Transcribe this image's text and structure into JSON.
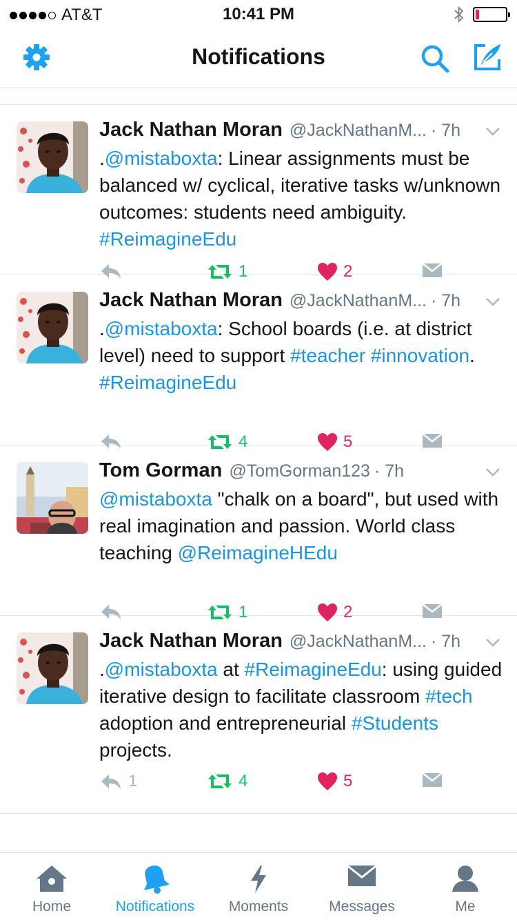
{
  "status_bar": {
    "carrier": "AT&T",
    "time": "10:41 PM",
    "signal_bars_filled": 4,
    "signal_bars_total": 5,
    "battery_level": 0.05
  },
  "nav": {
    "title": "Notifications",
    "icons": [
      "gear-icon",
      "search-icon",
      "compose-icon"
    ]
  },
  "colors": {
    "accent": "#1da1f2",
    "link": "#1b95e0",
    "retweet": "#17bf63",
    "like": "#e0245e",
    "muted": "#657786"
  },
  "tweets": [
    {
      "name": "Jack Nathan Moran",
      "handle": "@JackNathanM...",
      "time": "· 7h",
      "text": [
        {
          "t": ".",
          "link": false
        },
        {
          "t": "@mistaboxta",
          "link": true
        },
        {
          "t": ": Linear assignments must be balanced w/ cyclical, iterative tasks w/unknown outcomes: students need ambiguity. ",
          "link": false
        },
        {
          "t": "#ReimagineEdu",
          "link": true
        }
      ],
      "reply_count": "",
      "retweet_count": "1",
      "like_count": "2"
    },
    {
      "name": "Jack Nathan Moran",
      "handle": "@JackNathanM...",
      "time": "· 7h",
      "text": [
        {
          "t": ".",
          "link": false
        },
        {
          "t": "@mistaboxta",
          "link": true
        },
        {
          "t": ": School boards (i.e. at district level) need to support ",
          "link": false
        },
        {
          "t": "#teacher",
          "link": true
        },
        {
          "t": " ",
          "link": false
        },
        {
          "t": "#innovation",
          "link": true
        },
        {
          "t": ". ",
          "link": false
        },
        {
          "t": "#ReimagineEdu",
          "link": true
        }
      ],
      "reply_count": "",
      "retweet_count": "4",
      "like_count": "5"
    },
    {
      "name": "Tom Gorman",
      "handle": "@TomGorman123",
      "time": "· 7h",
      "text": [
        {
          "t": "@mistaboxta",
          "link": true
        },
        {
          "t": " \"chalk on a board\", but used with real imagination and passion. World class teaching ",
          "link": false
        },
        {
          "t": "@ReimagineHEdu",
          "link": true
        }
      ],
      "reply_count": "",
      "retweet_count": "1",
      "like_count": "2"
    },
    {
      "name": "Jack Nathan Moran",
      "handle": "@JackNathanM...",
      "time": "· 7h",
      "text": [
        {
          "t": ".",
          "link": false
        },
        {
          "t": "@mistaboxta",
          "link": true
        },
        {
          "t": " at ",
          "link": false
        },
        {
          "t": "#ReimagineEdu",
          "link": true
        },
        {
          "t": ": using guided iterative design to facilitate classroom ",
          "link": false
        },
        {
          "t": "#tech",
          "link": true
        },
        {
          "t": " adoption and entrepreneurial ",
          "link": false
        },
        {
          "t": "#Students",
          "link": true
        },
        {
          "t": " projects.",
          "link": false
        }
      ],
      "reply_count": "1",
      "retweet_count": "4",
      "like_count": "5"
    }
  ],
  "tabbar": {
    "tabs": [
      {
        "label": "Home",
        "icon": "home-icon"
      },
      {
        "label": "Notifications",
        "icon": "bell-icon",
        "active": true
      },
      {
        "label": "Moments",
        "icon": "lightning-icon"
      },
      {
        "label": "Messages",
        "icon": "envelope-icon"
      },
      {
        "label": "Me",
        "icon": "person-icon"
      }
    ]
  }
}
